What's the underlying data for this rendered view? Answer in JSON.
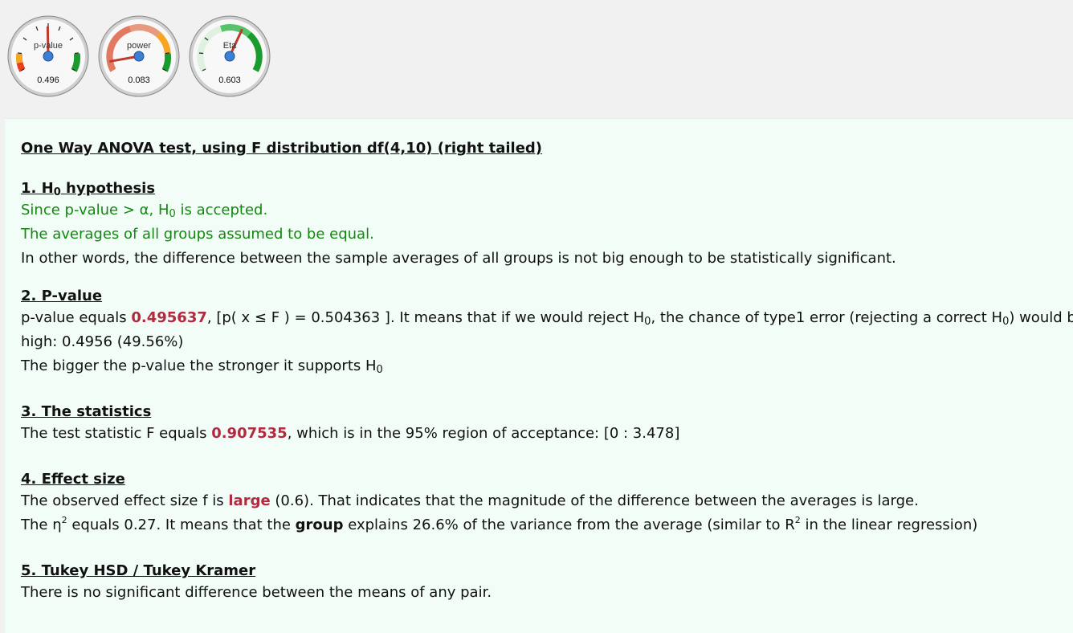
{
  "gauges": [
    {
      "label": "p-value",
      "value_text": "0.496",
      "value": 0.496
    },
    {
      "label": "power",
      "value_text": "0.083",
      "value": 0.083
    },
    {
      "label": "Eta",
      "value_text": "0.603",
      "value": 0.603
    }
  ],
  "title": "One Way ANOVA test, using F distribution df(4,10) (right tailed)",
  "h0_symbol": {
    "letter": "H",
    "sub": "0"
  },
  "sections": {
    "hypothesis": {
      "heading_prefix": "1. H",
      "heading_suffix": " hypothesis",
      "line1_a": "Since p-value > α, H",
      "line1_b": " is accepted.",
      "line2": "The averages of all groups assumed to be equal.",
      "line3": "In other words, the difference between the sample averages of all groups is not big enough to be statistically significant."
    },
    "pvalue": {
      "heading": "2. P-value",
      "text_a": "p-value equals ",
      "pvalue": "0.495637",
      "text_b": ", [p( x ≤ F ) = 0.504363 ]. It means that if we would reject H",
      "text_c": ", the chance of type1 error (rejecting a correct H",
      "text_d": ") would be too",
      "line2": "high: 0.4956 (49.56%)",
      "line3_a": "The bigger the p-value the stronger it supports H"
    },
    "statistics": {
      "heading": "3. The statistics",
      "text_a": "The test statistic F equals ",
      "fvalue": "0.907535",
      "text_b": ", which is in the 95% region of acceptance: [0 : 3.478]"
    },
    "effect": {
      "heading": "4. Effect size",
      "l1_a": "The observed effect size f is ",
      "l1_size": "large",
      "l1_b": " (0.6). That indicates that the magnitude of the difference between the averages is large.",
      "l2_a": "The η",
      "l2_sup": "2",
      "l2_b": " equals 0.27. It means that the ",
      "l2_group": "group",
      "l2_c": " explains 26.6% of the variance from the average (similar to R",
      "l2_d": " in the linear regression)"
    },
    "tukey": {
      "heading": "5. Tukey HSD / Tukey Kramer",
      "line1": "There is no significant difference between the means of any pair."
    }
  },
  "colors": {
    "accept_green": "#13870f",
    "highlight_red": "#b22a3f",
    "panel_bg": "#f3fdf8",
    "page_bg": "#f1f1f1",
    "needle": "#c0392b",
    "hub": "#3b7fd6"
  }
}
